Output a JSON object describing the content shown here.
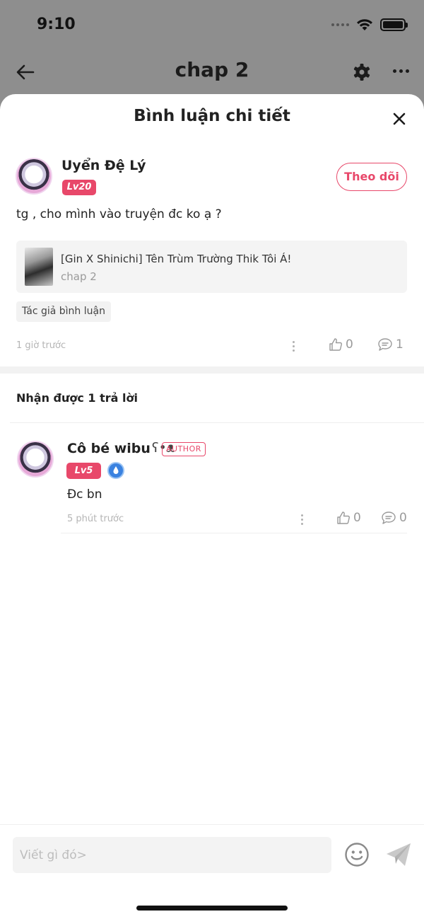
{
  "status_bar": {
    "time": "9:10"
  },
  "topbar": {
    "title": "chap 2"
  },
  "sheet": {
    "title": "Bình luận chi tiết"
  },
  "comment": {
    "author": "Uyển Đệ Lý",
    "level": "Lv20",
    "follow_label": "Theo dõi",
    "text": "tg , cho mình vào truyện đc ko ạ ?",
    "story": {
      "title": "[Gin X Shinichi] Tên Trùm Trường Thik Tôi Á!",
      "chapter": "chap 2"
    },
    "tag": "Tác giả bình luận",
    "time": "1 giờ trước",
    "likes": "0",
    "replies": "1"
  },
  "replies_header": "Nhận được 1 trả lời",
  "reply": {
    "author": "Cô bé wibu",
    "author_suffix": "ʕ•ᴥ",
    "author_badge": "AUTHOR",
    "level": "Lv5",
    "text": "Đc bn",
    "time": "5 phút trước",
    "likes": "0",
    "replies": "0"
  },
  "input": {
    "placeholder": "Viết gì đó>"
  },
  "colors": {
    "accent": "#e8486a",
    "badge_blue": "#3a82e0"
  }
}
